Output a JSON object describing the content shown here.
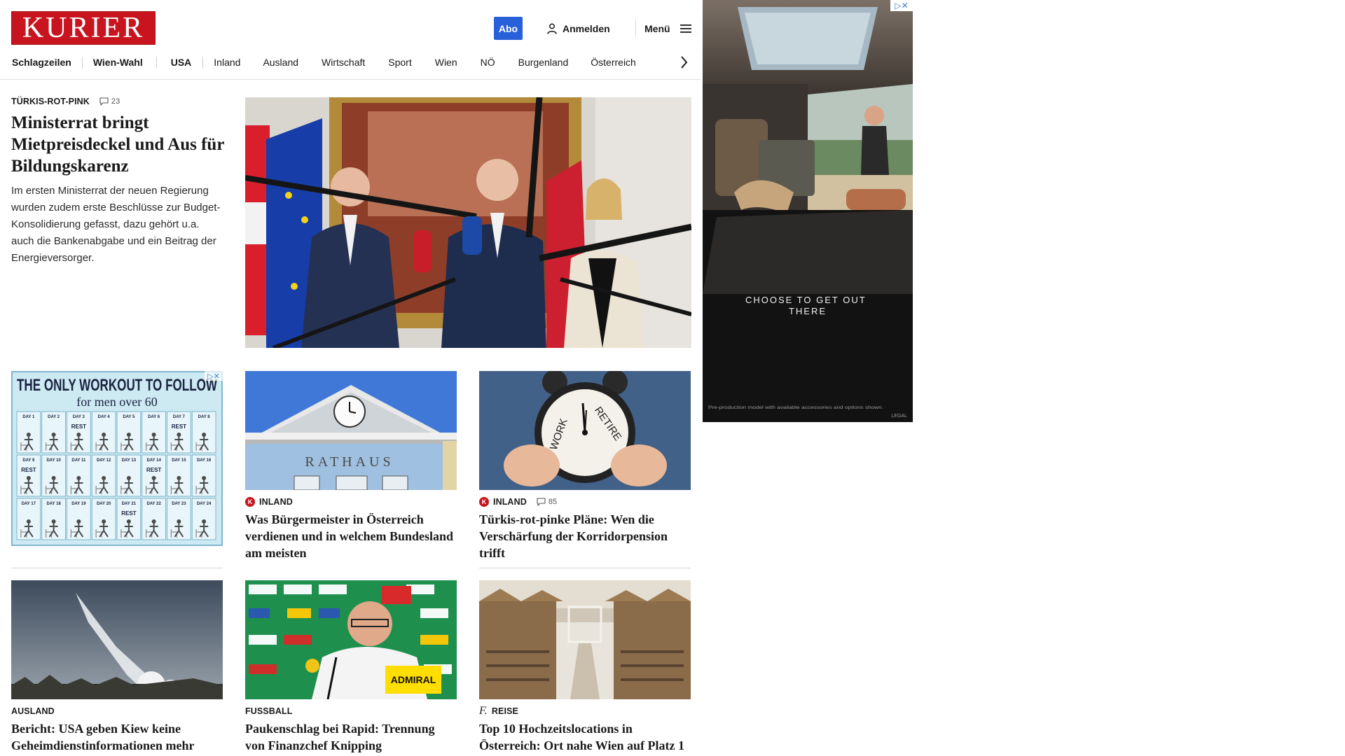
{
  "header": {
    "logo": "KURIER",
    "abo": "Abo",
    "login": "Anmelden",
    "menu": "Menü"
  },
  "nav": {
    "items": [
      "Schlagzeilen",
      "Wien-Wahl",
      "USA",
      "Inland",
      "Ausland",
      "Wirtschaft",
      "Sport",
      "Wien",
      "NÖ",
      "Burgenland",
      "Österreich"
    ]
  },
  "lead": {
    "kicker": "TÜRKIS-ROT-PINK",
    "comments": "23",
    "title": "Ministerrat bringt Mietpreisdeckel und Aus für Bildungskarenz",
    "teaser": "Im ersten Ministerrat der neuen Regierung wurden zudem erste Beschlüsse zur Budget-Konsolidierung gefasst, dazu gehört u.a. auch die Bankenabgabe und ein Beitrag der Energieversorger."
  },
  "ad_left": {
    "headline": "THE ONLY WORKOUT TO FOLLOW",
    "subline": "for men over 60",
    "days": [
      "DAY 1",
      "DAY 2",
      "DAY 3",
      "DAY 4",
      "DAY 5",
      "DAY 6",
      "DAY 7",
      "DAY 8",
      "DAY 9",
      "DAY 10",
      "DAY 11",
      "DAY 12",
      "DAY 13",
      "DAY 14",
      "DAY 15",
      "DAY 16",
      "DAY 17",
      "DAY 18",
      "DAY 19",
      "DAY 20",
      "DAY 21",
      "DAY 22",
      "DAY 23",
      "DAY 24"
    ],
    "rest": "REST"
  },
  "cards": [
    {
      "kicker": "INLAND",
      "badge": "K",
      "comments": "",
      "title": "Was Bürgermeister in Österreich verdienen und in welchem Bundesland am meisten",
      "image_text": "RATHAUS"
    },
    {
      "kicker": "INLAND",
      "badge": "K",
      "comments": "85",
      "title": "Türkis-rot-pinke Pläne: Wen die Verschärfung der Korridorpension trifft",
      "image_text_1": "WORK",
      "image_text_2": "RETIRE"
    },
    {
      "kicker": "AUSLAND",
      "title": "Bericht: USA geben Kiew keine Geheimdienstinformationen mehr"
    },
    {
      "kicker": "FUSSBALL",
      "title": "Paukenschlag bei Rapid: Trennung von Finanzchef Knipping",
      "image_text": "ADMIRAL"
    },
    {
      "kicker": "REISE",
      "title": "Top 10 Hochzeitslocations in Österreich: Ort nahe Wien auf Platz 1"
    }
  ],
  "ad_right": {
    "tagline": "CHOOSE TO GET OUT THERE",
    "disclaimer": "Pre-production model with available accessories and options shown.",
    "legal": "LEGAL"
  }
}
